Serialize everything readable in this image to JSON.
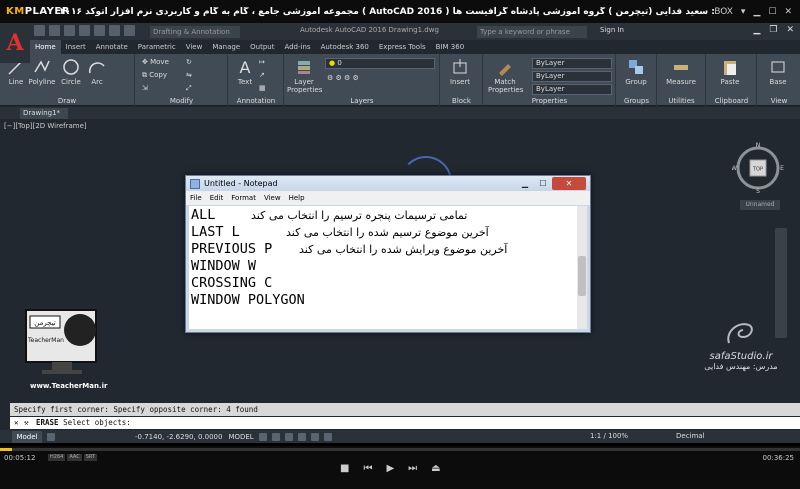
{
  "player": {
    "logo_prefix": "KM",
    "logo_suffix": "PLAYER",
    "caption": "مجموعه آموزشی جامع ، گام به گام و کاربردی نرم افزار اتوکد ۲۰۱۶ ( AutoCAD 2016 ) مدرس : سعید فدایی (تیچرمن ) گروه آموزشی پادشاه گرافیست ها",
    "box_label": "BOX",
    "time_current": "00:05:12",
    "time_total": "00:36:25",
    "badges": [
      "H264",
      "AAC",
      "SRT"
    ]
  },
  "autocad": {
    "app_letter": "A",
    "workspace": "Drafting & Annotation",
    "doc_title": "Autodesk AutoCAD 2016   Drawing1.dwg",
    "search_placeholder": "Type a keyword or phrase",
    "signin": "Sign In",
    "tabs": [
      "Home",
      "Insert",
      "Annotate",
      "Parametric",
      "View",
      "Manage",
      "Output",
      "Add-ins",
      "Autodesk 360",
      "Express Tools",
      "BIM 360"
    ],
    "ribbon": {
      "draw": {
        "label": "Draw",
        "tools": [
          "Line",
          "Polyline",
          "Circle",
          "Arc"
        ]
      },
      "modify": {
        "label": "Modify",
        "tools": [
          "Move",
          "Copy"
        ]
      },
      "annotation": {
        "label": "Annotation",
        "tools": [
          "Text"
        ]
      },
      "layers": {
        "label": "Layers",
        "tool": "Layer Properties",
        "current": "0"
      },
      "block": {
        "label": "Block",
        "tool": "Insert"
      },
      "properties": {
        "label": "Properties",
        "tool": "Match Properties",
        "bylayer": "ByLayer"
      },
      "groups": {
        "label": "Groups",
        "tool": "Group"
      },
      "utilities": {
        "label": "Utilities",
        "tool": "Measure"
      },
      "clipboard": {
        "label": "Clipboard",
        "tool": "Paste"
      },
      "view": {
        "label": "View",
        "tool": "Base"
      }
    },
    "file_tab": "Drawing1*",
    "viewport_label": "[−][Top][2D Wireframe]",
    "viewcube": {
      "face": "TOP",
      "n": "N",
      "s": "S",
      "e": "E",
      "w": "W",
      "ucs": "Unnamed"
    },
    "command_history": "Specify first corner: Specify opposite corner: 4 found",
    "command_prompt_bold": "ERASE",
    "command_prompt": "Select objects:",
    "status": {
      "model_tab": "Model",
      "coords": "-0.7140, -2.6290, 0.0000",
      "model": "MODEL",
      "scale": "1:1 / 100%",
      "units": "Decimal"
    }
  },
  "notepad": {
    "title": "Untitled - Notepad",
    "menu": [
      "File",
      "Edit",
      "Format",
      "View",
      "Help"
    ],
    "lines": [
      {
        "en": "ALL",
        "fa": "تمامی ترسیمات پنجره ترسیم را انتخاب می کند"
      },
      {
        "en": "LAST  L",
        "fa": "آخرین موضوع ترسیم شده را  انتخاب می کند"
      },
      {
        "en": "PREVIOUS P",
        "fa": "آخرین موضوع ویرایش شده را انتخاب می کند"
      },
      {
        "en": "WINDOW W",
        "fa": ""
      },
      {
        "en": "CROSSING C",
        "fa": ""
      },
      {
        "en": "WINDOW POLYGON",
        "fa": ""
      }
    ]
  },
  "watermarks": {
    "teacherman_url": "www.TeacherMan.ir",
    "teacherman_logo_text": "تیچرمن",
    "teacherman_sub": "TeacherMan",
    "safa_url": "safaStudio.ir",
    "safa_name": "مدرس: مهندس فدایی"
  },
  "colors": {
    "acad_red": "#e0312f",
    "ribbon": "#414b55",
    "canvas": "#212830",
    "kmp_accent": "#f7b500"
  }
}
